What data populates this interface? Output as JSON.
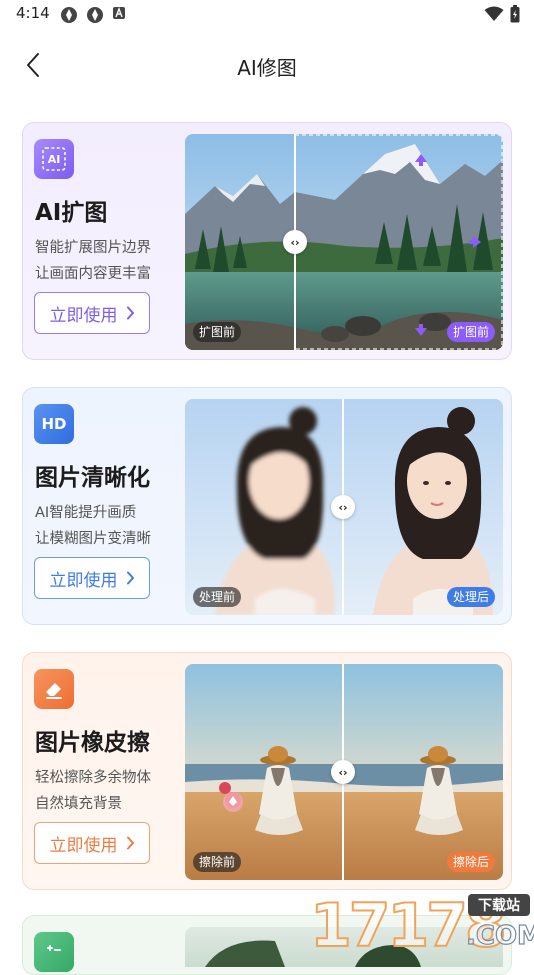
{
  "status_bar": {
    "time": "4:14"
  },
  "header": {
    "title": "AI修图"
  },
  "cards": [
    {
      "icon_text": "AI",
      "title": "AI扩图",
      "desc_line1": "智能扩展图片边界",
      "desc_line2": "让画面内容更丰富",
      "button": "立即使用",
      "tag_before": "扩图前",
      "tag_after": "扩图前",
      "accent": "#8b6cf0"
    },
    {
      "icon_text": "HD",
      "title": "图片清晰化",
      "desc_line1": "AI智能提升画质",
      "desc_line2": "让模糊图片变清晰",
      "button": "立即使用",
      "tag_before": "处理前",
      "tag_after": "处理后",
      "accent": "#3f7ce8"
    },
    {
      "icon_text": "",
      "title": "图片橡皮擦",
      "desc_line1": "轻松擦除多余物体",
      "desc_line2": "自然填充背景",
      "button": "立即使用",
      "tag_before": "擦除前",
      "tag_after": "擦除后",
      "accent": "#f07a3e"
    }
  ],
  "watermark": {
    "number": "17178",
    "label": "下载站",
    "suffix": ".COM"
  }
}
